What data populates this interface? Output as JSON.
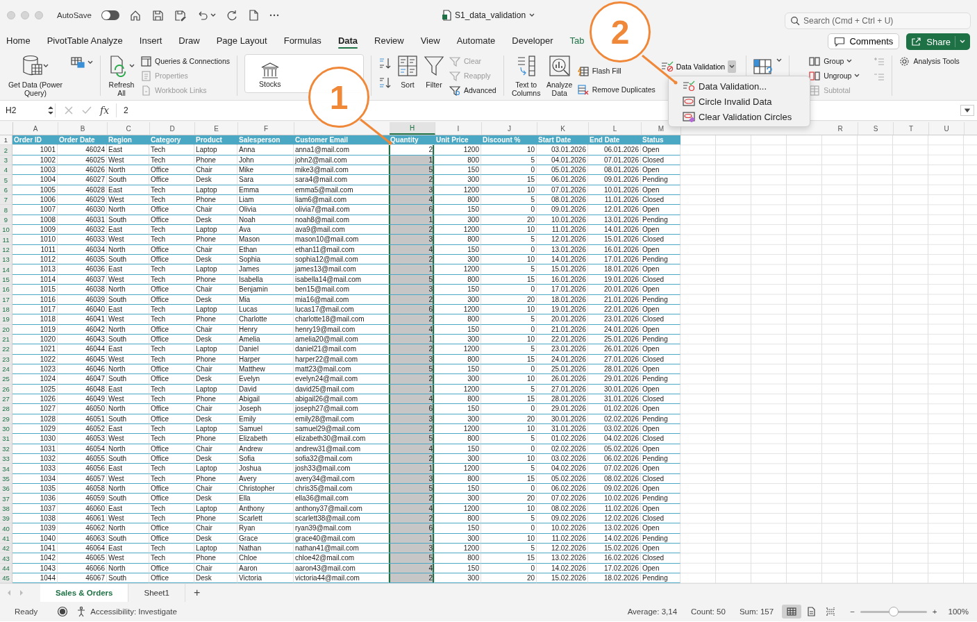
{
  "window": {
    "title": "S1_data_validation"
  },
  "autosave": {
    "label": "AutoSave",
    "on": false
  },
  "search": {
    "placeholder": "Search (Cmd + Ctrl + U)"
  },
  "tabs": [
    {
      "label": "Home",
      "selected": false,
      "kind": "standard"
    },
    {
      "label": "PivotTable Analyze",
      "selected": false,
      "kind": "standard"
    },
    {
      "label": "Insert",
      "selected": false,
      "kind": "standard"
    },
    {
      "label": "Draw",
      "selected": false,
      "kind": "standard"
    },
    {
      "label": "Page Layout",
      "selected": false,
      "kind": "standard"
    },
    {
      "label": "Formulas",
      "selected": false,
      "kind": "standard"
    },
    {
      "label": "Data",
      "selected": true,
      "kind": "standard"
    },
    {
      "label": "Review",
      "selected": false,
      "kind": "standard"
    },
    {
      "label": "View",
      "selected": false,
      "kind": "standard"
    },
    {
      "label": "Automate",
      "selected": false,
      "kind": "standard"
    },
    {
      "label": "Developer",
      "selected": false,
      "kind": "standard"
    },
    {
      "label": "Tab",
      "selected": false,
      "kind": "contextual"
    }
  ],
  "comments_button": {
    "label": "Comments"
  },
  "share_button": {
    "label": "Share"
  },
  "ribbon": {
    "get_data": {
      "label": "Get Data (Power Query)"
    },
    "refresh_all": {
      "label": "Refresh All"
    },
    "queries": {
      "label": "Queries & Connections",
      "disabled": false
    },
    "properties": {
      "label": "Properties",
      "disabled": true
    },
    "workbook_links": {
      "label": "Workbook Links",
      "disabled": true
    },
    "stocks": {
      "label": "Stocks"
    },
    "sort": {
      "label": "Sort"
    },
    "filter": {
      "label": "Filter"
    },
    "clear": {
      "label": "Clear",
      "disabled": true
    },
    "reapply": {
      "label": "Reapply",
      "disabled": true
    },
    "advanced": {
      "label": "Advanced",
      "disabled": false
    },
    "text_to_columns": {
      "label": "Text to Columns"
    },
    "analyze_data": {
      "label": "Analyze Data"
    },
    "flash_fill": {
      "label": "Flash Fill"
    },
    "remove_duplicates": {
      "label": "Remove Duplicates"
    },
    "data_validation": {
      "label": "Data Validation",
      "expanded": true
    },
    "group": {
      "label": "Group",
      "disabled": false
    },
    "ungroup": {
      "label": "Ungroup",
      "disabled": false
    },
    "subtotal": {
      "label": "Subtotal",
      "disabled": true
    },
    "analysis_tools": {
      "label": "Analysis Tools"
    }
  },
  "validation_menu": [
    {
      "label": "Data Validation..."
    },
    {
      "label": "Circle Invalid Data"
    },
    {
      "label": "Clear Validation Circles"
    }
  ],
  "formula_bar": {
    "name_box": "H2",
    "fx": "fx",
    "value": "2"
  },
  "columns": [
    {
      "kind": "letter",
      "letter": "A",
      "selected": false
    },
    {
      "kind": "letter",
      "letter": "B",
      "selected": false
    },
    {
      "kind": "letter",
      "letter": "C",
      "selected": false
    },
    {
      "kind": "letter",
      "letter": "D",
      "selected": false
    },
    {
      "kind": "letter",
      "letter": "E",
      "selected": false
    },
    {
      "kind": "letter",
      "letter": "F",
      "selected": false
    },
    {
      "kind": "covered"
    },
    {
      "kind": "letter",
      "letter": "H",
      "selected": true
    },
    {
      "kind": "letter",
      "letter": "I",
      "selected": false
    },
    {
      "kind": "letter",
      "letter": "J",
      "selected": false
    },
    {
      "kind": "letter",
      "letter": "K",
      "selected": false
    },
    {
      "kind": "letter",
      "letter": "L",
      "selected": false
    },
    {
      "kind": "letter",
      "letter": "M",
      "selected": false
    },
    {
      "kind": "covered"
    },
    {
      "kind": "covered"
    },
    {
      "kind": "covered"
    },
    {
      "kind": "covered"
    },
    {
      "kind": "letter",
      "letter": "R",
      "selected": false
    },
    {
      "kind": "letter",
      "letter": "S",
      "selected": false
    },
    {
      "kind": "letter",
      "letter": "T",
      "selected": false
    },
    {
      "kind": "letter",
      "letter": "U",
      "selected": false
    }
  ],
  "header_row": {
    "row_number": "1",
    "cells": [
      "Order ID",
      "Order Date",
      "Region",
      "Category",
      "Product",
      "Salesperson",
      "Customer Email",
      "Quantity",
      "Unit Price",
      "Discount %",
      "Start Date",
      "End Date",
      "Status"
    ]
  },
  "rows": [
    {
      "row_number": "2",
      "selected": true,
      "active": true,
      "cells": [
        "1001",
        "46024",
        "East",
        "Tech",
        "Laptop",
        "Anna",
        "anna1@mail.com",
        "2",
        "1200",
        "10",
        "03.01.2026",
        "06.01.2026",
        "Open"
      ]
    },
    {
      "row_number": "3",
      "selected": true,
      "active": false,
      "cells": [
        "1002",
        "46025",
        "West",
        "Tech",
        "Phone",
        "John",
        "john2@mail.com",
        "1",
        "800",
        "5",
        "04.01.2026",
        "07.01.2026",
        "Closed"
      ]
    },
    {
      "row_number": "4",
      "selected": true,
      "active": false,
      "cells": [
        "1003",
        "46026",
        "North",
        "Office",
        "Chair",
        "Mike",
        "mike3@mail.com",
        "5",
        "150",
        "0",
        "05.01.2026",
        "08.01.2026",
        "Open"
      ]
    },
    {
      "row_number": "5",
      "selected": true,
      "active": false,
      "cells": [
        "1004",
        "46027",
        "South",
        "Office",
        "Desk",
        "Sara",
        "sara4@mail.com",
        "2",
        "300",
        "15",
        "06.01.2026",
        "09.01.2026",
        "Pending"
      ]
    },
    {
      "row_number": "6",
      "selected": true,
      "active": false,
      "cells": [
        "1005",
        "46028",
        "East",
        "Tech",
        "Laptop",
        "Emma",
        "emma5@mail.com",
        "3",
        "1200",
        "10",
        "07.01.2026",
        "10.01.2026",
        "Open"
      ]
    },
    {
      "row_number": "7",
      "selected": true,
      "active": false,
      "cells": [
        "1006",
        "46029",
        "West",
        "Tech",
        "Phone",
        "Liam",
        "liam6@mail.com",
        "4",
        "800",
        "5",
        "08.01.2026",
        "11.01.2026",
        "Closed"
      ]
    },
    {
      "row_number": "8",
      "selected": true,
      "active": false,
      "cells": [
        "1007",
        "46030",
        "North",
        "Office",
        "Chair",
        "Olivia",
        "olivia7@mail.com",
        "6",
        "150",
        "0",
        "09.01.2026",
        "12.01.2026",
        "Open"
      ]
    },
    {
      "row_number": "9",
      "selected": true,
      "active": false,
      "cells": [
        "1008",
        "46031",
        "South",
        "Office",
        "Desk",
        "Noah",
        "noah8@mail.com",
        "1",
        "300",
        "20",
        "10.01.2026",
        "13.01.2026",
        "Pending"
      ]
    },
    {
      "row_number": "10",
      "selected": true,
      "active": false,
      "cells": [
        "1009",
        "46032",
        "East",
        "Tech",
        "Laptop",
        "Ava",
        "ava9@mail.com",
        "2",
        "1200",
        "10",
        "11.01.2026",
        "14.01.2026",
        "Open"
      ]
    },
    {
      "row_number": "11",
      "selected": true,
      "active": false,
      "cells": [
        "1010",
        "46033",
        "West",
        "Tech",
        "Phone",
        "Mason",
        "mason10@mail.com",
        "3",
        "800",
        "5",
        "12.01.2026",
        "15.01.2026",
        "Closed"
      ]
    },
    {
      "row_number": "12",
      "selected": true,
      "active": false,
      "cells": [
        "1011",
        "46034",
        "North",
        "Office",
        "Chair",
        "Ethan",
        "ethan11@mail.com",
        "4",
        "150",
        "0",
        "13.01.2026",
        "16.01.2026",
        "Open"
      ]
    },
    {
      "row_number": "13",
      "selected": true,
      "active": false,
      "cells": [
        "1012",
        "46035",
        "South",
        "Office",
        "Desk",
        "Sophia",
        "sophia12@mail.com",
        "2",
        "300",
        "10",
        "14.01.2026",
        "17.01.2026",
        "Pending"
      ]
    },
    {
      "row_number": "14",
      "selected": true,
      "active": false,
      "cells": [
        "1013",
        "46036",
        "East",
        "Tech",
        "Laptop",
        "James",
        "james13@mail.com",
        "1",
        "1200",
        "5",
        "15.01.2026",
        "18.01.2026",
        "Open"
      ]
    },
    {
      "row_number": "15",
      "selected": true,
      "active": false,
      "cells": [
        "1014",
        "46037",
        "West",
        "Tech",
        "Phone",
        "Isabella",
        "isabella14@mail.com",
        "5",
        "800",
        "15",
        "16.01.2026",
        "19.01.2026",
        "Closed"
      ]
    },
    {
      "row_number": "16",
      "selected": true,
      "active": false,
      "cells": [
        "1015",
        "46038",
        "North",
        "Office",
        "Chair",
        "Benjamin",
        "ben15@mail.com",
        "3",
        "150",
        "0",
        "17.01.2026",
        "20.01.2026",
        "Open"
      ]
    },
    {
      "row_number": "17",
      "selected": true,
      "active": false,
      "cells": [
        "1016",
        "46039",
        "South",
        "Office",
        "Desk",
        "Mia",
        "mia16@mail.com",
        "2",
        "300",
        "20",
        "18.01.2026",
        "21.01.2026",
        "Pending"
      ]
    },
    {
      "row_number": "18",
      "selected": true,
      "active": false,
      "cells": [
        "1017",
        "46040",
        "East",
        "Tech",
        "Laptop",
        "Lucas",
        "lucas17@mail.com",
        "6",
        "1200",
        "10",
        "19.01.2026",
        "22.01.2026",
        "Open"
      ]
    },
    {
      "row_number": "19",
      "selected": true,
      "active": false,
      "cells": [
        "1018",
        "46041",
        "West",
        "Tech",
        "Phone",
        "Charlotte",
        "charlotte18@mail.com",
        "2",
        "800",
        "5",
        "20.01.2026",
        "23.01.2026",
        "Closed"
      ]
    },
    {
      "row_number": "20",
      "selected": true,
      "active": false,
      "cells": [
        "1019",
        "46042",
        "North",
        "Office",
        "Chair",
        "Henry",
        "henry19@mail.com",
        "4",
        "150",
        "0",
        "21.01.2026",
        "24.01.2026",
        "Open"
      ]
    },
    {
      "row_number": "21",
      "selected": true,
      "active": false,
      "cells": [
        "1020",
        "46043",
        "South",
        "Office",
        "Desk",
        "Amelia",
        "amelia20@mail.com",
        "1",
        "300",
        "10",
        "22.01.2026",
        "25.01.2026",
        "Pending"
      ]
    },
    {
      "row_number": "22",
      "selected": true,
      "active": false,
      "cells": [
        "1021",
        "46044",
        "East",
        "Tech",
        "Laptop",
        "Daniel",
        "daniel21@mail.com",
        "2",
        "1200",
        "5",
        "23.01.2026",
        "26.01.2026",
        "Open"
      ]
    },
    {
      "row_number": "23",
      "selected": true,
      "active": false,
      "cells": [
        "1022",
        "46045",
        "West",
        "Tech",
        "Phone",
        "Harper",
        "harper22@mail.com",
        "3",
        "800",
        "15",
        "24.01.2026",
        "27.01.2026",
        "Closed"
      ]
    },
    {
      "row_number": "24",
      "selected": true,
      "active": false,
      "cells": [
        "1023",
        "46046",
        "North",
        "Office",
        "Chair",
        "Matthew",
        "matt23@mail.com",
        "5",
        "150",
        "0",
        "25.01.2026",
        "28.01.2026",
        "Open"
      ]
    },
    {
      "row_number": "25",
      "selected": true,
      "active": false,
      "cells": [
        "1024",
        "46047",
        "South",
        "Office",
        "Desk",
        "Evelyn",
        "evelyn24@mail.com",
        "2",
        "300",
        "10",
        "26.01.2026",
        "29.01.2026",
        "Pending"
      ]
    },
    {
      "row_number": "26",
      "selected": true,
      "active": false,
      "cells": [
        "1025",
        "46048",
        "East",
        "Tech",
        "Laptop",
        "David",
        "david25@mail.com",
        "1",
        "1200",
        "5",
        "27.01.2026",
        "30.01.2026",
        "Open"
      ]
    },
    {
      "row_number": "27",
      "selected": true,
      "active": false,
      "cells": [
        "1026",
        "46049",
        "West",
        "Tech",
        "Phone",
        "Abigail",
        "abigail26@mail.com",
        "4",
        "800",
        "15",
        "28.01.2026",
        "31.01.2026",
        "Closed"
      ]
    },
    {
      "row_number": "28",
      "selected": true,
      "active": false,
      "cells": [
        "1027",
        "46050",
        "North",
        "Office",
        "Chair",
        "Joseph",
        "joseph27@mail.com",
        "6",
        "150",
        "0",
        "29.01.2026",
        "01.02.2026",
        "Open"
      ]
    },
    {
      "row_number": "29",
      "selected": true,
      "active": false,
      "cells": [
        "1028",
        "46051",
        "South",
        "Office",
        "Desk",
        "Emily",
        "emily28@mail.com",
        "3",
        "300",
        "20",
        "30.01.2026",
        "02.02.2026",
        "Pending"
      ]
    },
    {
      "row_number": "30",
      "selected": true,
      "active": false,
      "cells": [
        "1029",
        "46052",
        "East",
        "Tech",
        "Laptop",
        "Samuel",
        "samuel29@mail.com",
        "2",
        "1200",
        "10",
        "31.01.2026",
        "03.02.2026",
        "Open"
      ]
    },
    {
      "row_number": "31",
      "selected": true,
      "active": false,
      "cells": [
        "1030",
        "46053",
        "West",
        "Tech",
        "Phone",
        "Elizabeth",
        "elizabeth30@mail.com",
        "5",
        "800",
        "5",
        "01.02.2026",
        "04.02.2026",
        "Closed"
      ]
    },
    {
      "row_number": "32",
      "selected": true,
      "active": false,
      "cells": [
        "1031",
        "46054",
        "North",
        "Office",
        "Chair",
        "Andrew",
        "andrew31@mail.com",
        "4",
        "150",
        "0",
        "02.02.2026",
        "05.02.2026",
        "Open"
      ]
    },
    {
      "row_number": "33",
      "selected": true,
      "active": false,
      "cells": [
        "1032",
        "46055",
        "South",
        "Office",
        "Desk",
        "Sofia",
        "sofia32@mail.com",
        "2",
        "300",
        "10",
        "03.02.2026",
        "06.02.2026",
        "Pending"
      ]
    },
    {
      "row_number": "34",
      "selected": true,
      "active": false,
      "cells": [
        "1033",
        "46056",
        "East",
        "Tech",
        "Laptop",
        "Joshua",
        "josh33@mail.com",
        "1",
        "1200",
        "5",
        "04.02.2026",
        "07.02.2026",
        "Open"
      ]
    },
    {
      "row_number": "35",
      "selected": true,
      "active": false,
      "cells": [
        "1034",
        "46057",
        "West",
        "Tech",
        "Phone",
        "Avery",
        "avery34@mail.com",
        "3",
        "800",
        "15",
        "05.02.2026",
        "08.02.2026",
        "Closed"
      ]
    },
    {
      "row_number": "36",
      "selected": true,
      "active": false,
      "cells": [
        "1035",
        "46058",
        "North",
        "Office",
        "Chair",
        "Christopher",
        "chris35@mail.com",
        "5",
        "150",
        "0",
        "06.02.2026",
        "09.02.2026",
        "Open"
      ]
    },
    {
      "row_number": "37",
      "selected": true,
      "active": false,
      "cells": [
        "1036",
        "46059",
        "South",
        "Office",
        "Desk",
        "Ella",
        "ella36@mail.com",
        "2",
        "300",
        "20",
        "07.02.2026",
        "10.02.2026",
        "Pending"
      ]
    },
    {
      "row_number": "38",
      "selected": true,
      "active": false,
      "cells": [
        "1037",
        "46060",
        "East",
        "Tech",
        "Laptop",
        "Anthony",
        "anthony37@mail.com",
        "4",
        "1200",
        "10",
        "08.02.2026",
        "11.02.2026",
        "Open"
      ]
    },
    {
      "row_number": "39",
      "selected": true,
      "active": false,
      "cells": [
        "1038",
        "46061",
        "West",
        "Tech",
        "Phone",
        "Scarlett",
        "scarlett38@mail.com",
        "2",
        "800",
        "5",
        "09.02.2026",
        "12.02.2026",
        "Closed"
      ]
    },
    {
      "row_number": "40",
      "selected": true,
      "active": false,
      "cells": [
        "1039",
        "46062",
        "North",
        "Office",
        "Chair",
        "Ryan",
        "ryan39@mail.com",
        "6",
        "150",
        "0",
        "10.02.2026",
        "13.02.2026",
        "Open"
      ]
    },
    {
      "row_number": "41",
      "selected": true,
      "active": false,
      "cells": [
        "1040",
        "46063",
        "South",
        "Office",
        "Desk",
        "Grace",
        "grace40@mail.com",
        "1",
        "300",
        "10",
        "11.02.2026",
        "14.02.2026",
        "Pending"
      ]
    },
    {
      "row_number": "42",
      "selected": true,
      "active": false,
      "cells": [
        "1041",
        "46064",
        "East",
        "Tech",
        "Laptop",
        "Nathan",
        "nathan41@mail.com",
        "3",
        "1200",
        "5",
        "12.02.2026",
        "15.02.2026",
        "Open"
      ]
    },
    {
      "row_number": "43",
      "selected": true,
      "active": false,
      "cells": [
        "1042",
        "46065",
        "West",
        "Tech",
        "Phone",
        "Chloe",
        "chloe42@mail.com",
        "5",
        "800",
        "15",
        "13.02.2026",
        "16.02.2026",
        "Closed"
      ]
    },
    {
      "row_number": "44",
      "selected": true,
      "active": false,
      "cells": [
        "1043",
        "46066",
        "North",
        "Office",
        "Chair",
        "Aaron",
        "aaron43@mail.com",
        "4",
        "150",
        "0",
        "14.02.2026",
        "17.02.2026",
        "Open"
      ]
    },
    {
      "row_number": "45",
      "selected": true,
      "active": false,
      "cells": [
        "1044",
        "46067",
        "South",
        "Office",
        "Desk",
        "Victoria",
        "victoria44@mail.com",
        "2",
        "300",
        "20",
        "15.02.2026",
        "18.02.2026",
        "Pending"
      ]
    }
  ],
  "sheet_tabs": [
    {
      "label": "Sales & Orders",
      "selected": true
    },
    {
      "label": "Sheet1",
      "selected": false
    }
  ],
  "add_sheet": "+",
  "status_bar": {
    "ready": "Ready",
    "accessibility": "Accessibility: Investigate",
    "average": "Average: 3,14",
    "count": "Count: 50",
    "sum": "Sum: 157",
    "view_buttons": [
      {
        "selected": true
      },
      {
        "selected": false
      },
      {
        "selected": false
      }
    ],
    "zoom_minus": "−",
    "zoom_plus": "+",
    "zoom_slider": {
      "level": 0.5
    },
    "zoom": "100%"
  },
  "callouts": [
    {
      "label": "1"
    },
    {
      "label": "2"
    }
  ]
}
